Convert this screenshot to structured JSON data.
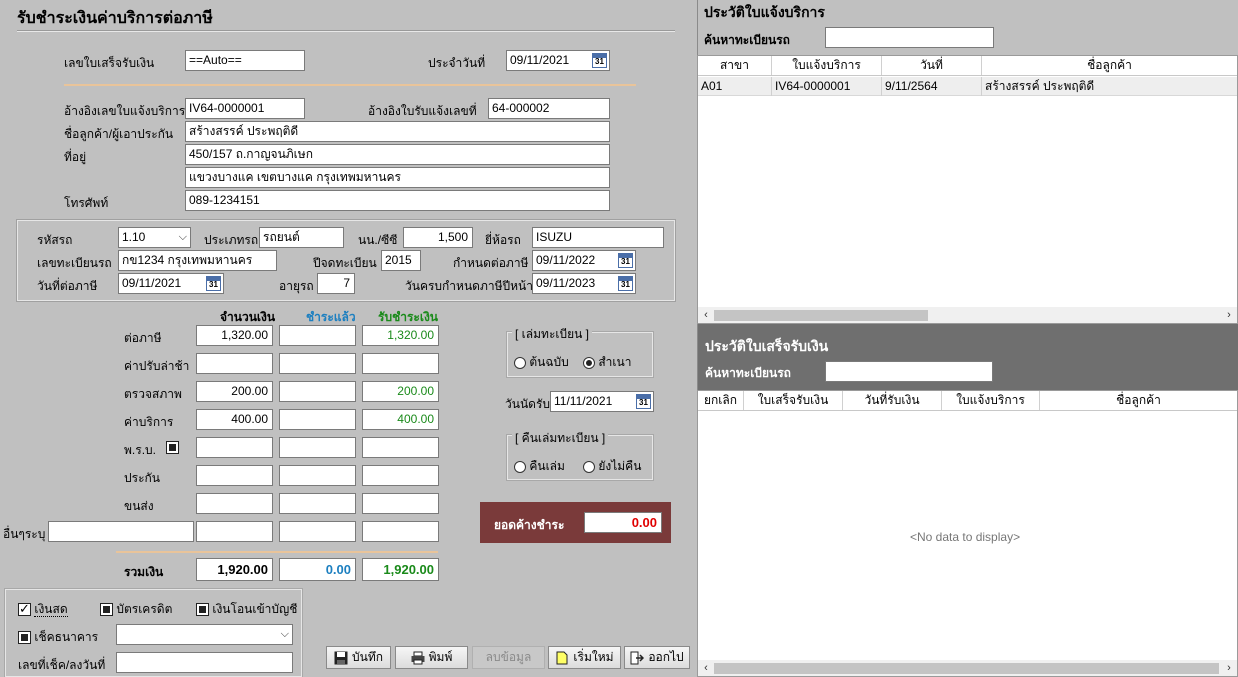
{
  "left": {
    "title": "รับชำระเงินค่าบริการต่อภาษี",
    "receipt": {
      "no_label": "เลขใบเสร็จรับเงิน",
      "no_value": "==Auto==",
      "date_label": "ประจำวันที่",
      "date_value": "09/11/2021"
    },
    "customer": {
      "ref_invoice_label": "อ้างอิงเลขใบแจ้งบริการ",
      "ref_invoice_value": "IV64-0000001",
      "ref_receive_label": "อ้างอิงใบรับแจ้งเลขที่",
      "ref_receive_value": "64-000002",
      "name_label": "ชื่อลูกค้า/ผู้เอาประกัน",
      "name_value": "สร้างสรรค์  ประพฤติดี",
      "address_label": "ที่อยู่",
      "address_line1": "450/157 ถ.กาญจนภิเษก",
      "address_line2": "แขวงบางแค เขตบางแค กรุงเทพมหานคร",
      "phone_label": "โทรศัพท์",
      "phone_value": "089-1234151"
    },
    "vehicle": {
      "code_label": "รหัสรถ",
      "code_value": "1.10",
      "type_label": "ประเภทรถ",
      "type_value": "รถยนต์",
      "weight_label": "นน./ซีซี",
      "weight_value": "1,500",
      "brand_label": "ยี่ห้อรถ",
      "brand_value": "ISUZU",
      "plate_label": "เลขทะเบียนรถ",
      "plate_value": "กข1234 กรุงเทพมหานคร",
      "regyear_label": "ปีจดทะเบียน",
      "regyear_value": "2015",
      "taxdue_label": "กำหนดต่อภาษี",
      "taxdue_value": "09/11/2022",
      "taxdate_label": "วันที่ต่อภาษี",
      "taxdate_value": "09/11/2021",
      "age_label": "อายุรถ",
      "age_value": "7",
      "nextdue_label": "วันครบกำหนดภาษีปีหน้า",
      "nextdue_value": "09/11/2023"
    },
    "fees": {
      "col_amount": "จำนวนเงิน",
      "col_paid": "ชำระแล้ว",
      "col_receive": "รับชำระเงิน",
      "rows": [
        {
          "label": "ต่อภาษี",
          "amount": "1,320.00",
          "paid": "",
          "receive": "1,320.00"
        },
        {
          "label": "ค่าปรับล่าช้า",
          "amount": "",
          "paid": "",
          "receive": ""
        },
        {
          "label": "ตรวจสภาพ",
          "amount": "200.00",
          "paid": "",
          "receive": "200.00"
        },
        {
          "label": "ค่าบริการ",
          "amount": "400.00",
          "paid": "",
          "receive": "400.00"
        },
        {
          "label": "พ.ร.บ.",
          "amount": "",
          "paid": "",
          "receive": ""
        },
        {
          "label": "ประกัน",
          "amount": "",
          "paid": "",
          "receive": ""
        },
        {
          "label": "ขนส่ง",
          "amount": "",
          "paid": "",
          "receive": ""
        },
        {
          "label": "อื่นๆระบุ",
          "amount": "",
          "paid": "",
          "receive": ""
        }
      ],
      "total_label": "รวมเงิน",
      "total_amount": "1,920.00",
      "total_paid": "0.00",
      "total_receive": "1,920.00"
    },
    "book_group": {
      "title": "[ เล่มทะเบียน ]",
      "opt1": "ต้นฉบับ",
      "opt2": "สำเนา",
      "selected": "สำเนา"
    },
    "appointment": {
      "label": "วันนัดรับ",
      "value": "11/11/2021"
    },
    "return_group": {
      "title": "[ คืนเล่มทะเบียน ]",
      "opt1": "คืนเล่ม",
      "opt2": "ยังไม่คืน"
    },
    "outstanding": {
      "label": "ยอดค้างชำระ",
      "value": "0.00"
    },
    "payment": {
      "cash": "เงินสด",
      "credit": "บัตรเครดิต",
      "transfer": "เงินโอนเข้าบัญชี",
      "cheque": "เช็คธนาคาร",
      "cheque_no_label": "เลขที่เช็ค/ลงวันที่"
    },
    "buttons": {
      "save": "บันทึก",
      "print": "พิมพ์",
      "delete": "ลบข้อมูล",
      "new": "เริ่มใหม่",
      "exit": "ออกไป"
    }
  },
  "right": {
    "invoice_history": {
      "title": "ประวัติใบแจ้งบริการ",
      "search_label": "ค้นหาทะเบียนรถ",
      "columns": [
        "สาขา",
        "ใบแจ้งบริการ",
        "วันที่",
        "ชื่อลูกค้า"
      ],
      "rows": [
        [
          "A01",
          "IV64-0000001",
          "9/11/2564",
          "สร้างสรรค์  ประพฤติดี"
        ]
      ]
    },
    "receipt_history": {
      "title": "ประวัติใบเสร็จรับเงิน",
      "search_label": "ค้นหาทะเบียนรถ",
      "columns": [
        "ยกเลิก",
        "ใบเสร็จรับเงิน",
        "วันที่รับเงิน",
        "ใบแจ้งบริการ",
        "ชื่อลูกค้า"
      ],
      "empty_text": "<No data to display>"
    }
  }
}
